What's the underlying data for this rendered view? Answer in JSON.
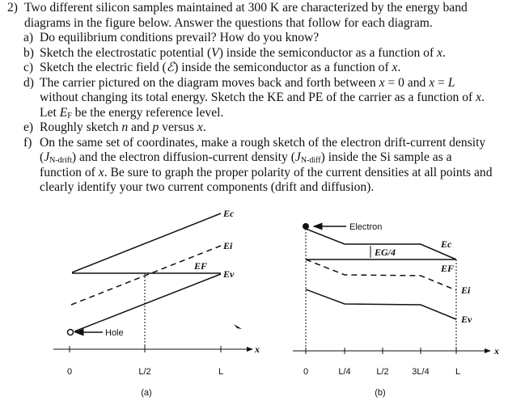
{
  "problem": {
    "number": "2)",
    "lines": [
      [
        {
          "t": "Two different silicon samples maintained at 300 K are characterized by the energy band"
        }
      ],
      [
        {
          "t": "diagrams in the figure below. Answer the questions that follow for each diagram."
        }
      ]
    ],
    "items": [
      {
        "label": "a)",
        "lines": [
          [
            {
              "t": "Do equilibrium conditions prevail? How do you know?"
            }
          ]
        ]
      },
      {
        "label": "b)",
        "lines": [
          [
            {
              "t": "Sketch the electrostatic potential ("
            },
            {
              "t": "V",
              "i": true
            },
            {
              "t": ") inside the semiconductor as a function of "
            },
            {
              "t": "x",
              "i": true
            },
            {
              "t": "."
            }
          ]
        ]
      },
      {
        "label": "c)",
        "lines": [
          [
            {
              "t": "Sketch the electric field ("
            },
            {
              "t": "ℰ",
              "i": true
            },
            {
              "t": ") inside the semiconductor as a function of "
            },
            {
              "t": "x",
              "i": true
            },
            {
              "t": "."
            }
          ]
        ]
      },
      {
        "label": "d)",
        "lines": [
          [
            {
              "t": "The carrier pictured on the diagram moves back and forth between "
            },
            {
              "t": "x",
              "i": true
            },
            {
              "t": " = 0 and "
            },
            {
              "t": "x",
              "i": true
            },
            {
              "t": " = "
            },
            {
              "t": "L",
              "i": true
            }
          ],
          [
            {
              "t": "without changing its total energy. Sketch the KE and PE of the carrier as a function of "
            },
            {
              "t": "x",
              "i": true
            },
            {
              "t": "."
            }
          ],
          [
            {
              "t": "Let "
            },
            {
              "t": "E",
              "i": true
            },
            {
              "t": "F",
              "sub": true
            },
            {
              "t": " be the energy reference level."
            }
          ]
        ]
      },
      {
        "label": "e)",
        "lines": [
          [
            {
              "t": "Roughly sketch "
            },
            {
              "t": "n",
              "i": true
            },
            {
              "t": " and "
            },
            {
              "t": "p",
              "i": true
            },
            {
              "t": " versus "
            },
            {
              "t": "x",
              "i": true
            },
            {
              "t": "."
            }
          ]
        ]
      },
      {
        "label": "f)",
        "lines": [
          [
            {
              "t": "On the same set of coordinates, make a rough sketch of the electron drift-current density"
            }
          ],
          [
            {
              "t": "("
            },
            {
              "t": "J",
              "i": true
            },
            {
              "t": "N-drift",
              "sub": true
            },
            {
              "t": ") and the electron diffusion-current density ("
            },
            {
              "t": "J",
              "i": true
            },
            {
              "t": "N-diff",
              "sub": true
            },
            {
              "t": ") inside the Si sample as a"
            }
          ],
          [
            {
              "t": "function of "
            },
            {
              "t": "x",
              "i": true
            },
            {
              "t": ". Be sure to graph the proper polarity of the current densities at all points and"
            }
          ],
          [
            {
              "t": "clearly identify your two current components (drift and diffusion)."
            }
          ]
        ]
      }
    ]
  },
  "figure_a": {
    "caption": "(a)",
    "labels": {
      "ec": "Ec",
      "ei": "Ei",
      "ef": "EF",
      "ev": "Ev",
      "hole": "Hole",
      "x": "x"
    },
    "ticks": [
      "0",
      "L/2",
      "L"
    ]
  },
  "figure_b": {
    "caption": "(b)",
    "labels": {
      "ec": "Ec",
      "ei": "Ei",
      "ef": "EF",
      "ev": "Ev",
      "electron": "Electron",
      "gap": "EG/4",
      "x": "x"
    },
    "ticks": [
      "0",
      "L/4",
      "L/2",
      "3L/4",
      "L"
    ]
  }
}
